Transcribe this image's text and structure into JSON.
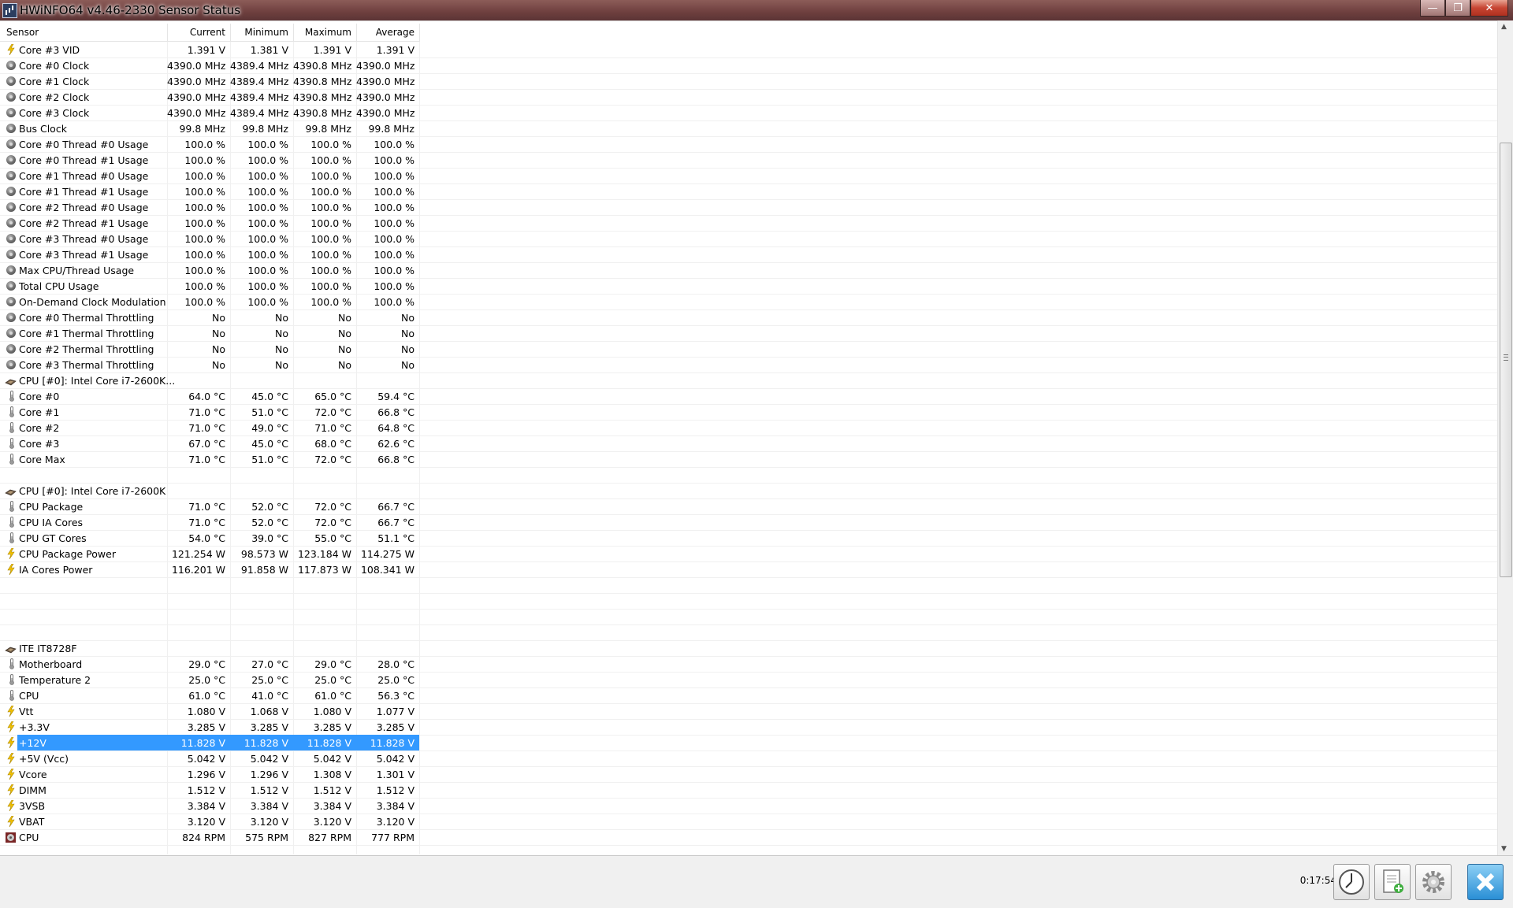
{
  "window": {
    "title": "HWiNFO64 v4.46-2330 Sensor Status",
    "ghost_tabs": "",
    "minimize_glyph": "—",
    "maximize_glyph": "❐",
    "close_glyph": "✕"
  },
  "header": {
    "sensor": "Sensor",
    "current": "Current",
    "minimum": "Minimum",
    "maximum": "Maximum",
    "average": "Average"
  },
  "rows": [
    {
      "icon": "bolt",
      "name": "Core #3 VID",
      "cur": "1.391 V",
      "min": "1.381 V",
      "max": "1.391 V",
      "avg": "1.391 V"
    },
    {
      "icon": "circle",
      "name": "Core #0 Clock",
      "cur": "4390.0 MHz",
      "min": "4389.4 MHz",
      "max": "4390.8 MHz",
      "avg": "4390.0 MHz"
    },
    {
      "icon": "circle",
      "name": "Core #1 Clock",
      "cur": "4390.0 MHz",
      "min": "4389.4 MHz",
      "max": "4390.8 MHz",
      "avg": "4390.0 MHz"
    },
    {
      "icon": "circle",
      "name": "Core #2 Clock",
      "cur": "4390.0 MHz",
      "min": "4389.4 MHz",
      "max": "4390.8 MHz",
      "avg": "4390.0 MHz"
    },
    {
      "icon": "circle",
      "name": "Core #3 Clock",
      "cur": "4390.0 MHz",
      "min": "4389.4 MHz",
      "max": "4390.8 MHz",
      "avg": "4390.0 MHz"
    },
    {
      "icon": "circle",
      "name": "Bus Clock",
      "cur": "99.8 MHz",
      "min": "99.8 MHz",
      "max": "99.8 MHz",
      "avg": "99.8 MHz"
    },
    {
      "icon": "circle",
      "name": "Core #0 Thread #0 Usage",
      "cur": "100.0 %",
      "min": "100.0 %",
      "max": "100.0 %",
      "avg": "100.0 %"
    },
    {
      "icon": "circle",
      "name": "Core #0 Thread #1 Usage",
      "cur": "100.0 %",
      "min": "100.0 %",
      "max": "100.0 %",
      "avg": "100.0 %"
    },
    {
      "icon": "circle",
      "name": "Core #1 Thread #0 Usage",
      "cur": "100.0 %",
      "min": "100.0 %",
      "max": "100.0 %",
      "avg": "100.0 %"
    },
    {
      "icon": "circle",
      "name": "Core #1 Thread #1 Usage",
      "cur": "100.0 %",
      "min": "100.0 %",
      "max": "100.0 %",
      "avg": "100.0 %"
    },
    {
      "icon": "circle",
      "name": "Core #2 Thread #0 Usage",
      "cur": "100.0 %",
      "min": "100.0 %",
      "max": "100.0 %",
      "avg": "100.0 %"
    },
    {
      "icon": "circle",
      "name": "Core #2 Thread #1 Usage",
      "cur": "100.0 %",
      "min": "100.0 %",
      "max": "100.0 %",
      "avg": "100.0 %"
    },
    {
      "icon": "circle",
      "name": "Core #3 Thread #0 Usage",
      "cur": "100.0 %",
      "min": "100.0 %",
      "max": "100.0 %",
      "avg": "100.0 %"
    },
    {
      "icon": "circle",
      "name": "Core #3 Thread #1 Usage",
      "cur": "100.0 %",
      "min": "100.0 %",
      "max": "100.0 %",
      "avg": "100.0 %"
    },
    {
      "icon": "circle",
      "name": "Max CPU/Thread Usage",
      "cur": "100.0 %",
      "min": "100.0 %",
      "max": "100.0 %",
      "avg": "100.0 %"
    },
    {
      "icon": "circle",
      "name": "Total CPU Usage",
      "cur": "100.0 %",
      "min": "100.0 %",
      "max": "100.0 %",
      "avg": "100.0 %"
    },
    {
      "icon": "circle",
      "name": "On-Demand Clock Modulation",
      "cur": "100.0 %",
      "min": "100.0 %",
      "max": "100.0 %",
      "avg": "100.0 %"
    },
    {
      "icon": "circle",
      "name": "Core #0 Thermal Throttling",
      "cur": "No",
      "min": "No",
      "max": "No",
      "avg": "No"
    },
    {
      "icon": "circle",
      "name": "Core #1 Thermal Throttling",
      "cur": "No",
      "min": "No",
      "max": "No",
      "avg": "No"
    },
    {
      "icon": "circle",
      "name": "Core #2 Thermal Throttling",
      "cur": "No",
      "min": "No",
      "max": "No",
      "avg": "No"
    },
    {
      "icon": "circle",
      "name": "Core #3 Thermal Throttling",
      "cur": "No",
      "min": "No",
      "max": "No",
      "avg": "No"
    },
    {
      "icon": "chip",
      "name": "CPU [#0]: Intel Core i7-2600K...",
      "cur": "",
      "min": "",
      "max": "",
      "avg": ""
    },
    {
      "icon": "therm",
      "name": "Core #0",
      "cur": "64.0 °C",
      "min": "45.0 °C",
      "max": "65.0 °C",
      "avg": "59.4 °C"
    },
    {
      "icon": "therm",
      "name": "Core #1",
      "cur": "71.0 °C",
      "min": "51.0 °C",
      "max": "72.0 °C",
      "avg": "66.8 °C"
    },
    {
      "icon": "therm",
      "name": "Core #2",
      "cur": "71.0 °C",
      "min": "49.0 °C",
      "max": "71.0 °C",
      "avg": "64.8 °C"
    },
    {
      "icon": "therm",
      "name": "Core #3",
      "cur": "67.0 °C",
      "min": "45.0 °C",
      "max": "68.0 °C",
      "avg": "62.6 °C"
    },
    {
      "icon": "therm",
      "name": "Core Max",
      "cur": "71.0 °C",
      "min": "51.0 °C",
      "max": "72.0 °C",
      "avg": "66.8 °C"
    },
    {
      "icon": "none",
      "name": "",
      "cur": "",
      "min": "",
      "max": "",
      "avg": ""
    },
    {
      "icon": "chip",
      "name": "CPU [#0]: Intel Core i7-2600K",
      "cur": "",
      "min": "",
      "max": "",
      "avg": ""
    },
    {
      "icon": "therm",
      "name": "CPU Package",
      "cur": "71.0 °C",
      "min": "52.0 °C",
      "max": "72.0 °C",
      "avg": "66.7 °C"
    },
    {
      "icon": "therm",
      "name": "CPU IA Cores",
      "cur": "71.0 °C",
      "min": "52.0 °C",
      "max": "72.0 °C",
      "avg": "66.7 °C"
    },
    {
      "icon": "therm",
      "name": "CPU GT Cores",
      "cur": "54.0 °C",
      "min": "39.0 °C",
      "max": "55.0 °C",
      "avg": "51.1 °C"
    },
    {
      "icon": "bolt",
      "name": "CPU Package Power",
      "cur": "121.254 W",
      "min": "98.573 W",
      "max": "123.184 W",
      "avg": "114.275 W"
    },
    {
      "icon": "bolt",
      "name": "IA Cores Power",
      "cur": "116.201 W",
      "min": "91.858 W",
      "max": "117.873 W",
      "avg": "108.341 W"
    },
    {
      "icon": "none",
      "name": "",
      "cur": "",
      "min": "",
      "max": "",
      "avg": ""
    },
    {
      "icon": "none",
      "name": "",
      "cur": "",
      "min": "",
      "max": "",
      "avg": ""
    },
    {
      "icon": "none",
      "name": "",
      "cur": "",
      "min": "",
      "max": "",
      "avg": ""
    },
    {
      "icon": "none",
      "name": "",
      "cur": "",
      "min": "",
      "max": "",
      "avg": ""
    },
    {
      "icon": "chip",
      "name": "ITE IT8728F",
      "cur": "",
      "min": "",
      "max": "",
      "avg": ""
    },
    {
      "icon": "therm",
      "name": "Motherboard",
      "cur": "29.0 °C",
      "min": "27.0 °C",
      "max": "29.0 °C",
      "avg": "28.0 °C"
    },
    {
      "icon": "therm",
      "name": "Temperature 2",
      "cur": "25.0 °C",
      "min": "25.0 °C",
      "max": "25.0 °C",
      "avg": "25.0 °C"
    },
    {
      "icon": "therm",
      "name": "CPU",
      "cur": "61.0 °C",
      "min": "41.0 °C",
      "max": "61.0 °C",
      "avg": "56.3 °C"
    },
    {
      "icon": "bolt",
      "name": "Vtt",
      "cur": "1.080 V",
      "min": "1.068 V",
      "max": "1.080 V",
      "avg": "1.077 V"
    },
    {
      "icon": "bolt",
      "name": "+3.3V",
      "cur": "3.285 V",
      "min": "3.285 V",
      "max": "3.285 V",
      "avg": "3.285 V"
    },
    {
      "icon": "bolt",
      "name": "+12V",
      "cur": "11.828 V",
      "min": "11.828 V",
      "max": "11.828 V",
      "avg": "11.828 V",
      "selected": true
    },
    {
      "icon": "bolt",
      "name": "+5V (Vcc)",
      "cur": "5.042 V",
      "min": "5.042 V",
      "max": "5.042 V",
      "avg": "5.042 V"
    },
    {
      "icon": "bolt",
      "name": "Vcore",
      "cur": "1.296 V",
      "min": "1.296 V",
      "max": "1.308 V",
      "avg": "1.301 V"
    },
    {
      "icon": "bolt",
      "name": "DIMM",
      "cur": "1.512 V",
      "min": "1.512 V",
      "max": "1.512 V",
      "avg": "1.512 V"
    },
    {
      "icon": "bolt",
      "name": "3VSB",
      "cur": "3.384 V",
      "min": "3.384 V",
      "max": "3.384 V",
      "avg": "3.384 V"
    },
    {
      "icon": "bolt",
      "name": "VBAT",
      "cur": "3.120 V",
      "min": "3.120 V",
      "max": "3.120 V",
      "avg": "3.120 V"
    },
    {
      "icon": "fan",
      "name": "CPU",
      "cur": "824 RPM",
      "min": "575 RPM",
      "max": "827 RPM",
      "avg": "777 RPM"
    }
  ],
  "footer": {
    "timer": "0:17:54"
  },
  "colors": {
    "selection": "#3399ff",
    "bolt": "#f2c200",
    "close_accent": "#2a8fd5"
  }
}
